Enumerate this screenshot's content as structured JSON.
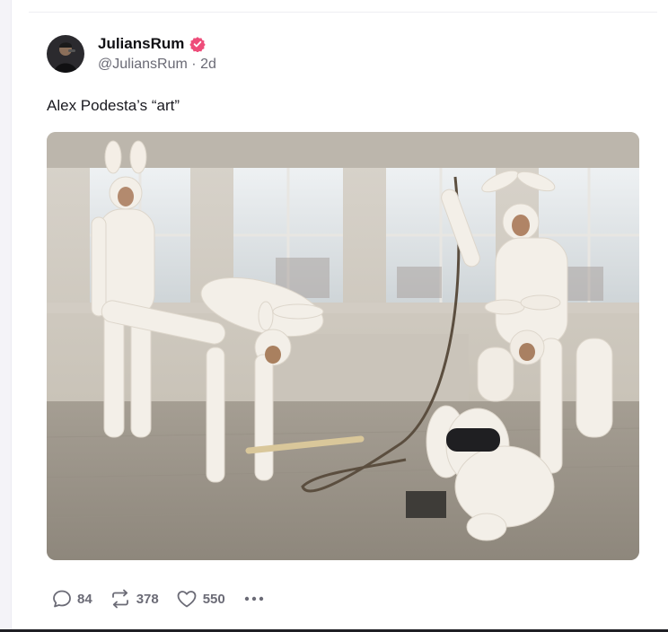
{
  "post": {
    "author": {
      "display_name": "JuliansRum",
      "handle": "@JuliansRum",
      "age": "2d",
      "verified": true
    },
    "text": "Alex Podesta’s “art”",
    "media_description": "Photo of several people in white bunny costumes posing in a bright room with windows",
    "actions": {
      "replies": "84",
      "reposts": "378",
      "likes": "550"
    }
  },
  "colors": {
    "verified_badge": "#ee4d7a",
    "muted_text": "#6a6a75",
    "icon": "#6b6b76"
  },
  "icons": {
    "reply": "speech-bubble-icon",
    "repost": "repost-arrows-icon",
    "like": "heart-icon",
    "more": "ellipsis-icon",
    "verified": "verified-badge-icon"
  }
}
